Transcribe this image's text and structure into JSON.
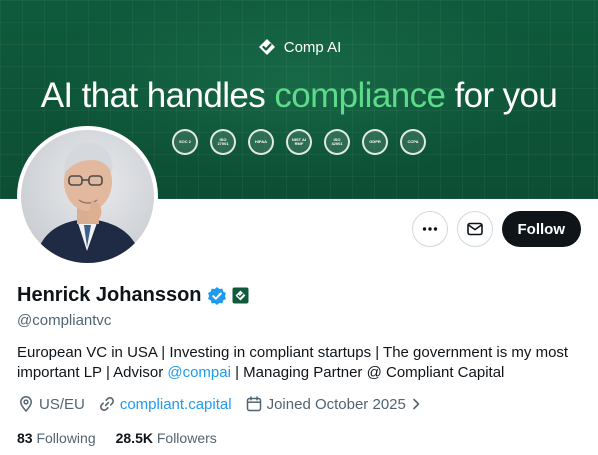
{
  "banner": {
    "brand_name": "Comp AI",
    "headline_prefix": "AI that handles ",
    "headline_accent": "compliance",
    "headline_suffix": " for you",
    "accent_color": "#5fd98a",
    "background_color": "#0f5a3c",
    "badges": [
      "SOC 2",
      "ISO 27001",
      "HIPAA",
      "NIST AI RMF",
      "ISO 42001",
      "GDPR",
      "CCPA"
    ]
  },
  "actions": {
    "more_icon": "more-icon",
    "message_icon": "mail-icon",
    "follow_label": "Follow"
  },
  "profile": {
    "name": "Henrick Johansson",
    "handle": "@compliantvc",
    "bio_before_mention": "European VC in USA | Investing in compliant startups | The government is my most important LP | Advisor ",
    "bio_mention": "@compai",
    "bio_after_mention": " | Managing Partner @ Compliant Capital",
    "location": "US/EU",
    "website": "compliant.capital",
    "joined": "Joined October 2025",
    "verified_color": "#1d9bf0",
    "affiliate_color": "#0f5a3c"
  },
  "stats": {
    "following_count": "83",
    "following_label": "Following",
    "followers_count": "28.5K",
    "followers_label": "Followers"
  }
}
